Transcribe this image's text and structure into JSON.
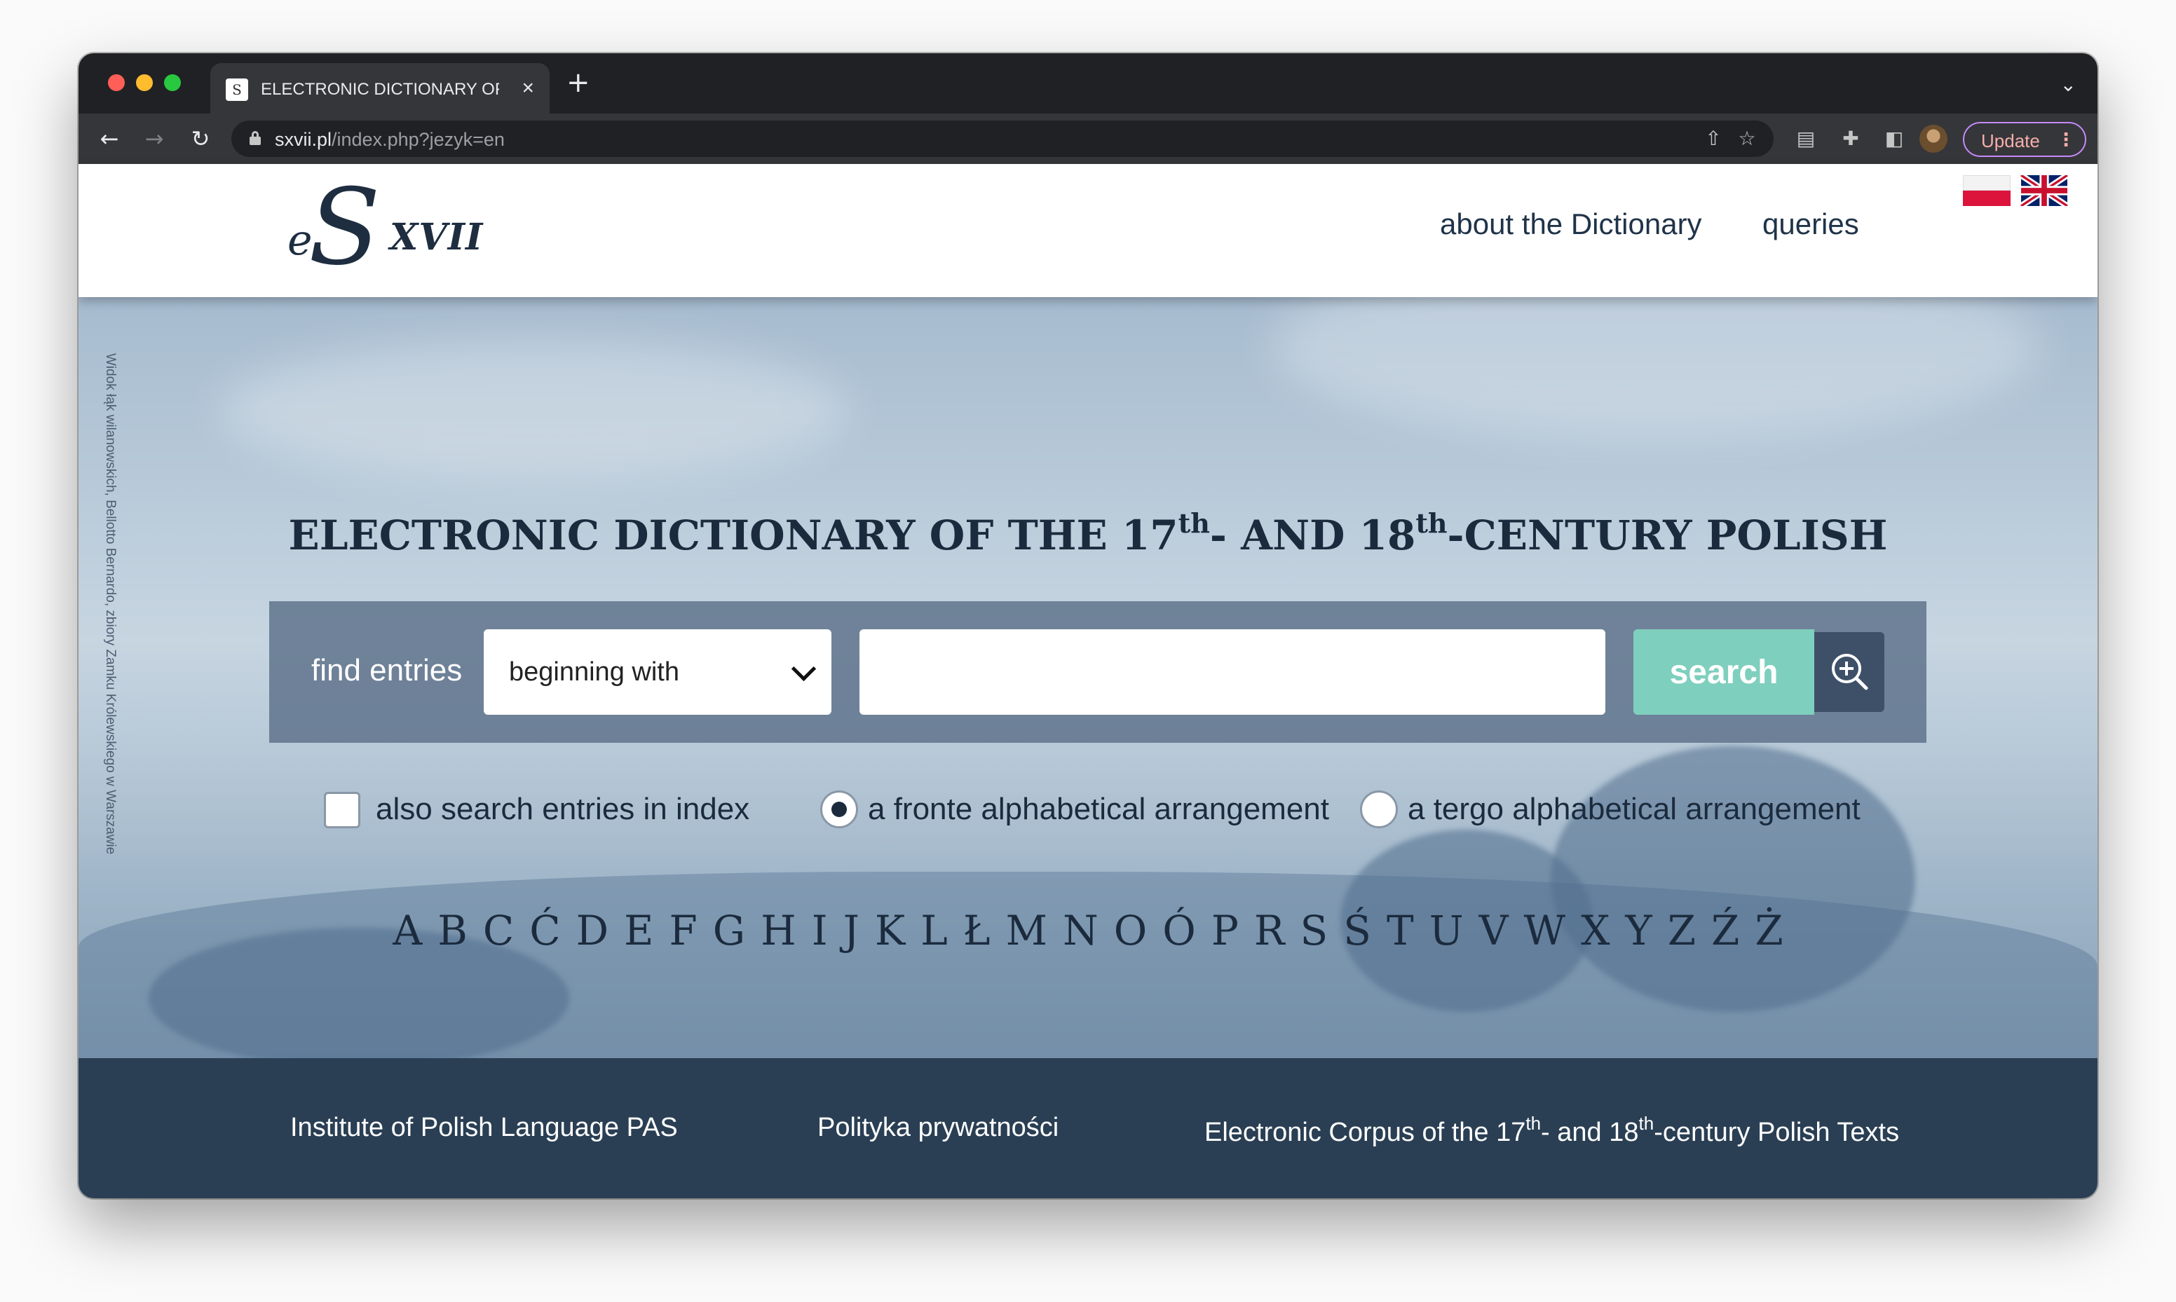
{
  "browser": {
    "tab_title": "ELECTRONIC DICTIONARY OF",
    "tab_close": "×",
    "new_tab": "+",
    "url_host": "sxvii.pl",
    "url_path": "/index.php?jezyk=en",
    "update_label": "Update"
  },
  "header": {
    "logo_e": "e",
    "logo_s": "S",
    "logo_xvii": "XVII",
    "nav": [
      "about the Dictionary",
      "queries"
    ]
  },
  "hero": {
    "credit": "Widok łąk wilanowskich, Bellotto Bernardo, zbiory Zamku Królewskiego w Warszawie",
    "title_pre": "ELECTRONIC DICTIONARY OF THE 17",
    "title_sup1": "th",
    "title_mid": "- AND 18",
    "title_sup2": "th",
    "title_post": "-CENTURY POLISH"
  },
  "search": {
    "find_label": "find entries",
    "mode_value": "beginning with",
    "query_value": "",
    "button_label": "search"
  },
  "options": {
    "index_checkbox_label": "also search entries in index",
    "index_checked": false,
    "a_fronte_label": "a fronte alphabetical arrangement",
    "a_tergo_label": "a tergo alphabetical arrangement",
    "selected_arrangement": "a fronte"
  },
  "alphabet": [
    "A",
    "B",
    "C",
    "Ć",
    "D",
    "E",
    "F",
    "G",
    "H",
    "I",
    "J",
    "K",
    "L",
    "Ł",
    "M",
    "N",
    "O",
    "Ó",
    "P",
    "R",
    "S",
    "Ś",
    "T",
    "U",
    "V",
    "W",
    "X",
    "Y",
    "Z",
    "Ź",
    "Ż"
  ],
  "footer": {
    "ijp": "Institute of Polish Language PAS",
    "privacy": "Polityka prywatności",
    "corpus_pre": "Electronic Corpus of the 17",
    "corpus_sup1": "th",
    "corpus_mid": "- and 18",
    "corpus_sup2": "th",
    "corpus_post": "-century Polish Texts"
  },
  "colors": {
    "footer_bg": "#2a3f54",
    "search_button": "#7fcfbe",
    "text_dark": "#1b2b3d"
  }
}
